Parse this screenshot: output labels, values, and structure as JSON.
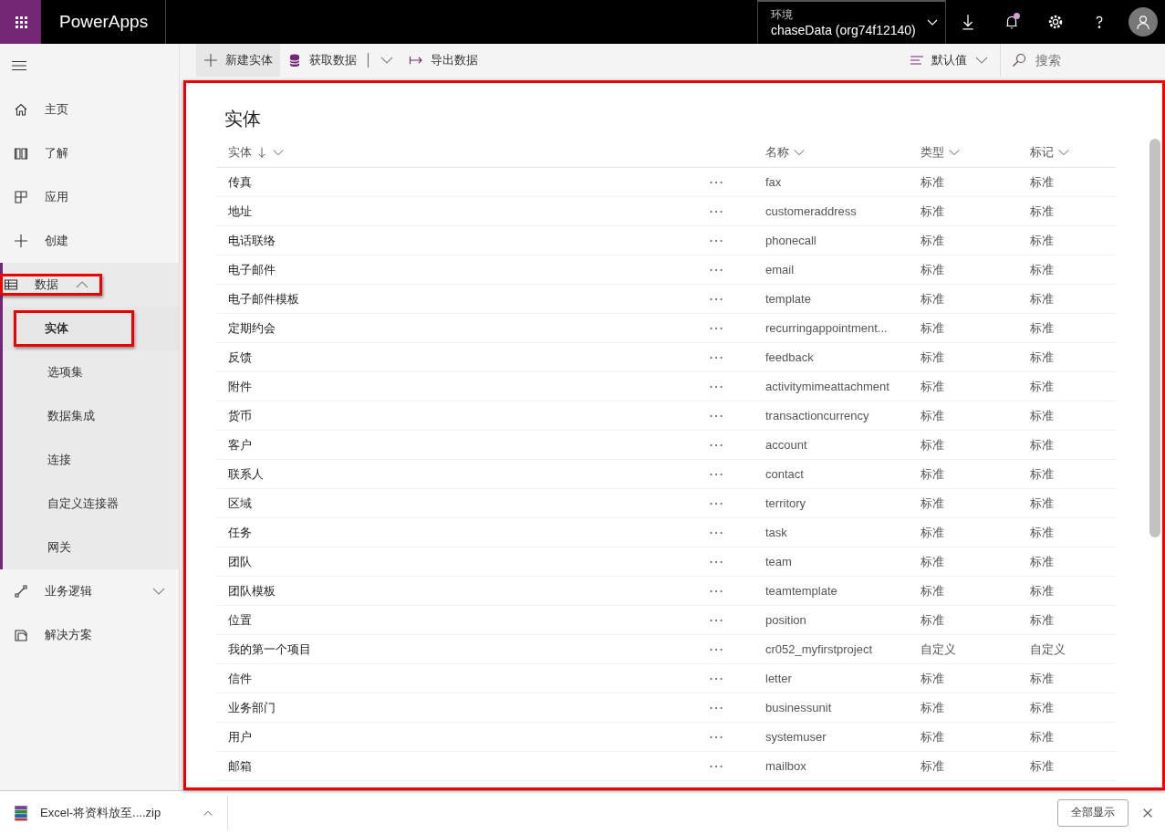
{
  "app": {
    "name": "PowerApps"
  },
  "environment": {
    "label": "环境",
    "value": "chaseData (org74f12140)"
  },
  "notifications": {
    "unread": true
  },
  "sidebar": {
    "items": [
      {
        "kind": "link",
        "label": "主页",
        "selected": false
      },
      {
        "kind": "link",
        "label": "了解",
        "selected": false
      },
      {
        "kind": "link",
        "label": "应用",
        "selected": false
      },
      {
        "kind": "link",
        "label": "创建",
        "selected": false
      },
      {
        "kind": "group",
        "label": "数据",
        "selected": false,
        "expanded": true,
        "highlighted": true,
        "children": [
          {
            "label": "实体",
            "selected": true,
            "highlighted": true
          },
          {
            "label": "选项集",
            "selected": false,
            "highlighted": false
          },
          {
            "label": "数据集成",
            "selected": false,
            "highlighted": false
          },
          {
            "label": "连接",
            "selected": false,
            "highlighted": false
          },
          {
            "label": "自定义连接器",
            "selected": false,
            "highlighted": false
          },
          {
            "label": "网关",
            "selected": false,
            "highlighted": false
          }
        ]
      },
      {
        "kind": "group",
        "label": "业务逻辑",
        "selected": false,
        "expanded": false,
        "highlighted": false
      },
      {
        "kind": "link",
        "label": "解决方案",
        "selected": false
      }
    ]
  },
  "toolbar": {
    "buttons": [
      {
        "label": "新建实体",
        "hovered": true,
        "dropdown": false
      },
      {
        "label": "获取数据",
        "hovered": false,
        "dropdown": true
      },
      {
        "label": "导出数据",
        "hovered": false,
        "dropdown": false
      }
    ],
    "view": {
      "label": "默认值"
    },
    "search": {
      "placeholder": "搜索"
    }
  },
  "content": {
    "highlighted": true,
    "title": "实体",
    "columns": [
      {
        "label": "实体",
        "sorted": true
      },
      {
        "label": "名称",
        "sorted": false
      },
      {
        "label": "类型",
        "sorted": false
      },
      {
        "label": "标记",
        "sorted": false
      }
    ],
    "rows": [
      {
        "entity": "传真",
        "name": "fax",
        "type": "标准",
        "tag": "标准"
      },
      {
        "entity": "地址",
        "name": "customeraddress",
        "type": "标准",
        "tag": "标准"
      },
      {
        "entity": "电话联络",
        "name": "phonecall",
        "type": "标准",
        "tag": "标准"
      },
      {
        "entity": "电子邮件",
        "name": "email",
        "type": "标准",
        "tag": "标准"
      },
      {
        "entity": "电子邮件模板",
        "name": "template",
        "type": "标准",
        "tag": "标准"
      },
      {
        "entity": "定期约会",
        "name": "recurringappointment...",
        "type": "标准",
        "tag": "标准"
      },
      {
        "entity": "反馈",
        "name": "feedback",
        "type": "标准",
        "tag": "标准"
      },
      {
        "entity": "附件",
        "name": "activitymimeattachment",
        "type": "标准",
        "tag": "标准"
      },
      {
        "entity": "货币",
        "name": "transactioncurrency",
        "type": "标准",
        "tag": "标准"
      },
      {
        "entity": "客户",
        "name": "account",
        "type": "标准",
        "tag": "标准"
      },
      {
        "entity": "联系人",
        "name": "contact",
        "type": "标准",
        "tag": "标准"
      },
      {
        "entity": "区域",
        "name": "territory",
        "type": "标准",
        "tag": "标准"
      },
      {
        "entity": "任务",
        "name": "task",
        "type": "标准",
        "tag": "标准"
      },
      {
        "entity": "团队",
        "name": "team",
        "type": "标准",
        "tag": "标准"
      },
      {
        "entity": "团队模板",
        "name": "teamtemplate",
        "type": "标准",
        "tag": "标准"
      },
      {
        "entity": "位置",
        "name": "position",
        "type": "标准",
        "tag": "标准"
      },
      {
        "entity": "我的第一个项目",
        "name": "cr052_myfirstproject",
        "type": "自定义",
        "tag": "自定义"
      },
      {
        "entity": "信件",
        "name": "letter",
        "type": "标准",
        "tag": "标准"
      },
      {
        "entity": "业务部门",
        "name": "businessunit",
        "type": "标准",
        "tag": "标准"
      },
      {
        "entity": "用户",
        "name": "systemuser",
        "type": "标准",
        "tag": "标准"
      },
      {
        "entity": "邮箱",
        "name": "mailbox",
        "type": "标准",
        "tag": "标准"
      }
    ]
  },
  "download_bar": {
    "file": "Excel-将资料放至....zip",
    "show_all": "全部显示"
  }
}
